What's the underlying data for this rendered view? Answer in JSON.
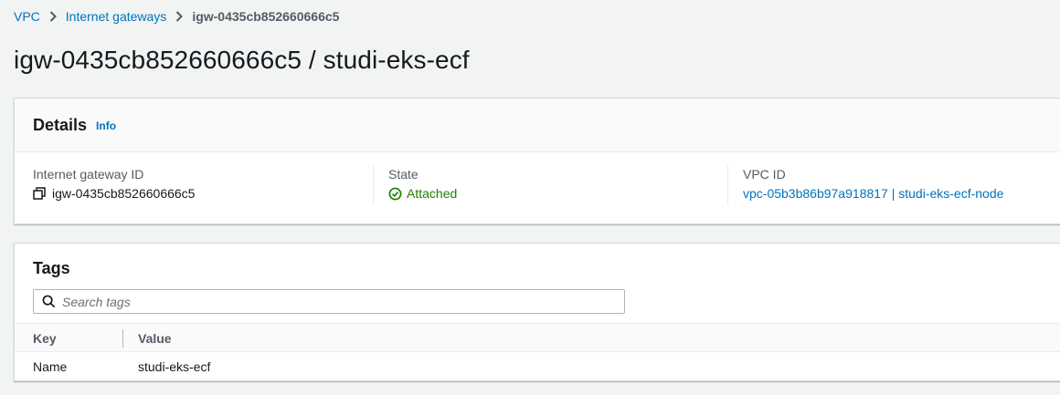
{
  "breadcrumb": {
    "items": [
      "VPC",
      "Internet gateways"
    ],
    "current": "igw-0435cb852660666c5"
  },
  "page": {
    "title": "igw-0435cb852660666c5 / studi-eks-ecf"
  },
  "details": {
    "heading": "Details",
    "info_label": "Info",
    "igw_id_label": "Internet gateway ID",
    "igw_id_value": "igw-0435cb852660666c5",
    "state_label": "State",
    "state_value": "Attached",
    "vpc_id_label": "VPC ID",
    "vpc_id_value": "vpc-05b3b86b97a918817 | studi-eks-ecf-node"
  },
  "tags": {
    "heading": "Tags",
    "search_placeholder": "Search tags",
    "columns": [
      "Key",
      "Value"
    ],
    "rows": [
      {
        "key": "Name",
        "value": "studi-eks-ecf"
      }
    ]
  },
  "colors": {
    "link": "#0073bb",
    "success": "#1d8102",
    "background": "#f2f3f3"
  },
  "icons": [
    "chevron-right-icon",
    "copy-icon",
    "check-circle-icon",
    "search-icon"
  ]
}
